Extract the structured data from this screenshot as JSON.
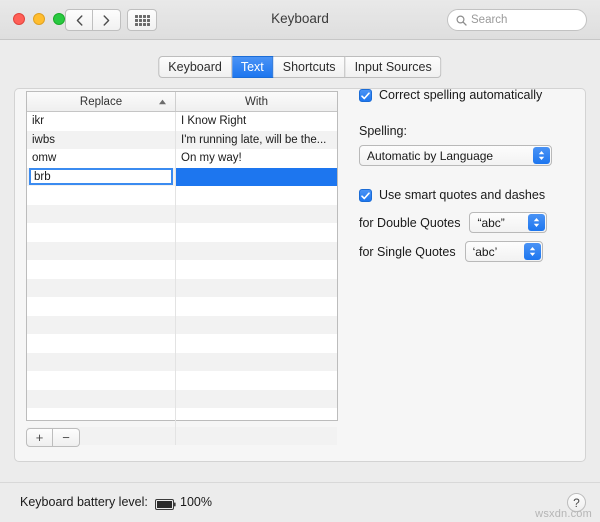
{
  "window": {
    "title": "Keyboard",
    "traffic_lights": [
      "close",
      "minimize",
      "zoom"
    ],
    "nav_back_label": "‹",
    "nav_forward_label": "›",
    "grid_button_name": "show-all-preferences",
    "search": {
      "placeholder": "Search",
      "value": ""
    }
  },
  "tabs": [
    {
      "label": "Keyboard",
      "active": false
    },
    {
      "label": "Text",
      "active": true
    },
    {
      "label": "Shortcuts",
      "active": false
    },
    {
      "label": "Input Sources",
      "active": false
    }
  ],
  "table": {
    "columns": [
      {
        "label": "Replace",
        "sorted": true,
        "sort_dir": "asc"
      },
      {
        "label": "With",
        "sorted": false
      }
    ],
    "rows": [
      {
        "replace": "ikr",
        "with": "I Know Right",
        "state": "normal"
      },
      {
        "replace": "iwbs",
        "with": "I'm running late, will be the...",
        "state": "normal"
      },
      {
        "replace": "omw",
        "with": "On my way!",
        "state": "normal"
      },
      {
        "replace": "brb",
        "with": "",
        "state": "editing-selected"
      }
    ],
    "empty_row_count": 14,
    "add_button_label": "+",
    "remove_button_label": "−"
  },
  "options": {
    "correct_spelling": {
      "label": "Correct spelling automatically",
      "checked": true
    },
    "spelling": {
      "label": "Spelling:",
      "value": "Automatic by Language"
    },
    "smart_quotes": {
      "label": "Use smart quotes and dashes",
      "checked": true
    },
    "double_quotes": {
      "label": "for Double Quotes",
      "value": "“abc”"
    },
    "single_quotes": {
      "label": "for Single Quotes",
      "value": "‘abc’"
    }
  },
  "footer": {
    "battery_label": "Keyboard battery level:",
    "battery_percent": "100%",
    "help_label": "?",
    "watermark": "wsxdn.com"
  },
  "colors": {
    "accent": "#1d76ef",
    "window_bg": "#ececec",
    "panel_bg": "#f6f6f6"
  }
}
